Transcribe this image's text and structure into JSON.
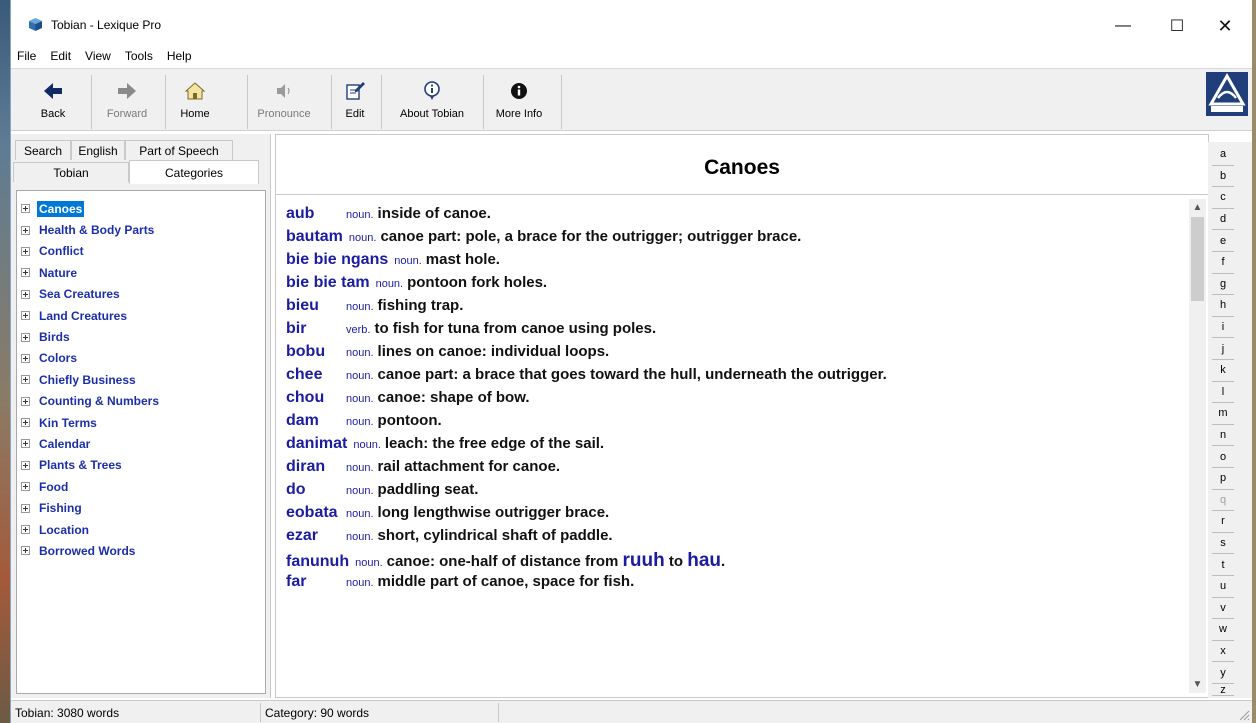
{
  "window": {
    "title": "Tobian - Lexique Pro"
  },
  "menu": [
    "File",
    "Edit",
    "View",
    "Tools",
    "Help"
  ],
  "toolbar": {
    "back": "Back",
    "forward": "Forward",
    "home": "Home",
    "pronounce": "Pronounce",
    "edit": "Edit",
    "about": "About Tobian",
    "more_info": "More Info"
  },
  "tabs": {
    "search": "Search",
    "english": "English",
    "part_of_speech": "Part of Speech",
    "tobian": "Tobian",
    "categories": "Categories"
  },
  "categories": [
    "Canoes",
    "Health & Body Parts",
    "Conflict",
    "Nature",
    "Sea Creatures",
    "Land Creatures",
    "Birds",
    "Colors",
    "Chiefly Business",
    "Counting & Numbers",
    "Kin Terms",
    "Calendar",
    "Plants & Trees",
    "Food",
    "Fishing",
    "Location",
    "Borrowed Words"
  ],
  "heading": "Canoes",
  "entries": [
    {
      "hw": "aub",
      "pos": "noun.",
      "def": "inside of canoe."
    },
    {
      "hw": "bautam",
      "pos": "noun.",
      "def": "canoe part: pole, a brace for the outrigger; outrigger brace."
    },
    {
      "hw": "bie bie ngans",
      "pos": "noun.",
      "def": "mast hole."
    },
    {
      "hw": "bie bie tam",
      "pos": "noun.",
      "def": "pontoon fork holes."
    },
    {
      "hw": "bieu",
      "pos": "noun.",
      "def": "fishing trap."
    },
    {
      "hw": "bir",
      "pos": "verb.",
      "def": "to fish for tuna from canoe using poles."
    },
    {
      "hw": "bobu",
      "pos": "noun.",
      "def": "lines on canoe: individual loops."
    },
    {
      "hw": "chee",
      "pos": "noun.",
      "def": "canoe part: a brace that goes toward the hull, underneath the outrigger."
    },
    {
      "hw": "chou",
      "pos": "noun.",
      "def": "canoe: shape of bow."
    },
    {
      "hw": "dam",
      "pos": "noun.",
      "def": "pontoon."
    },
    {
      "hw": "danimat",
      "pos": "noun.",
      "def": "leach: the free edge of the sail."
    },
    {
      "hw": "diran",
      "pos": "noun.",
      "def": "rail attachment for canoe."
    },
    {
      "hw": "do",
      "pos": "noun.",
      "def": "paddling seat."
    },
    {
      "hw": "eobata",
      "pos": "noun.",
      "def": "long lengthwise outrigger brace."
    },
    {
      "hw": "ezar",
      "pos": "noun.",
      "def": "short, cylindrical shaft of paddle."
    },
    {
      "hw": "fanunuh",
      "pos": "noun.",
      "def": "canoe: one-half of distance from",
      "x1": "ruuh",
      "mid": "to",
      "x2": "hau",
      "end": "."
    },
    {
      "hw": "far",
      "pos": "noun.",
      "def": "middle part of canoe, space for fish."
    }
  ],
  "alphabet": [
    "a",
    "b",
    "c",
    "d",
    "e",
    "f",
    "g",
    "h",
    "i",
    "j",
    "k",
    "l",
    "m",
    "n",
    "o",
    "p",
    "q",
    "r",
    "s",
    "t",
    "u",
    "v",
    "w",
    "x",
    "y",
    "z"
  ],
  "status": {
    "words": "Tobian: 3080 words",
    "category": "Category: 90 words"
  },
  "colors": {
    "accent": "#1c1ca0",
    "selection": "#0078d7"
  }
}
